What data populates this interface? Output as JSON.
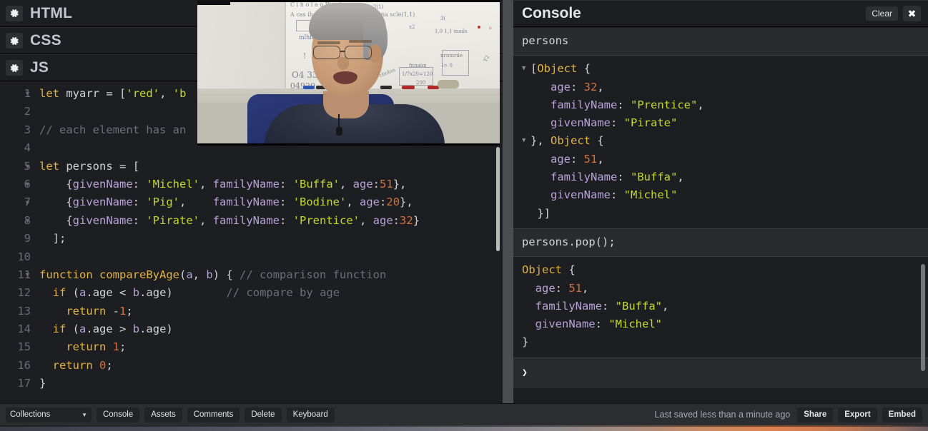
{
  "editor": {
    "panels": [
      {
        "label": "HTML",
        "icon": "gear-icon"
      },
      {
        "label": "CSS",
        "icon": "gear-icon"
      },
      {
        "label": "JS",
        "icon": "gear-icon"
      }
    ],
    "active_panel": "JS",
    "code_lines": [
      {
        "n": "1",
        "fold": true,
        "text": "let myarr = ['red', 'b"
      },
      {
        "n": "2",
        "fold": false,
        "text": ""
      },
      {
        "n": "3",
        "fold": false,
        "text": "// each element has an"
      },
      {
        "n": "4",
        "fold": false,
        "text": ""
      },
      {
        "n": "5",
        "fold": true,
        "text": "let persons = ["
      },
      {
        "n": "6",
        "fold": true,
        "text": "    {givenName: 'Michel', familyName: 'Buffa', age:51},"
      },
      {
        "n": "7",
        "fold": true,
        "text": "    {givenName: 'Pig',    familyName: 'Bodine', age:20},"
      },
      {
        "n": "8",
        "fold": true,
        "text": "    {givenName: 'Pirate', familyName: 'Prentice', age:32}"
      },
      {
        "n": "9",
        "fold": false,
        "text": "  ];"
      },
      {
        "n": "10",
        "fold": false,
        "text": ""
      },
      {
        "n": "11",
        "fold": true,
        "text": "function compareByAge(a, b) { // comparison function"
      },
      {
        "n": "12",
        "fold": false,
        "text": "  if (a.age < b.age)        // compare by age"
      },
      {
        "n": "13",
        "fold": false,
        "text": "    return -1;"
      },
      {
        "n": "14",
        "fold": false,
        "text": "  if (a.age > b.age)"
      },
      {
        "n": "15",
        "fold": false,
        "text": "    return 1;"
      },
      {
        "n": "16",
        "fold": false,
        "text": "  return 0;"
      },
      {
        "n": "17",
        "fold": false,
        "text": "}"
      }
    ]
  },
  "console": {
    "title": "Console",
    "clear_label": "Clear",
    "close_label": "✖",
    "entries": [
      {
        "type": "command",
        "text": "persons"
      },
      {
        "type": "output",
        "lines": [
          {
            "arrow": true,
            "text": "[Object {"
          },
          {
            "arrow": false,
            "text": "   age: 32,"
          },
          {
            "arrow": false,
            "text": "   familyName: \"Prentice\","
          },
          {
            "arrow": false,
            "text": "   givenName: \"Pirate\""
          },
          {
            "arrow": true,
            "text": "}, Object {"
          },
          {
            "arrow": false,
            "text": "   age: 51,"
          },
          {
            "arrow": false,
            "text": "   familyName: \"Buffa\","
          },
          {
            "arrow": false,
            "text": "   givenName: \"Michel\""
          },
          {
            "arrow": false,
            "text": " }]"
          }
        ]
      },
      {
        "type": "command",
        "text": "persons.pop();"
      },
      {
        "type": "output",
        "lines": [
          {
            "arrow": false,
            "text": "Object {"
          },
          {
            "arrow": false,
            "text": "  age: 51,"
          },
          {
            "arrow": false,
            "text": "  familyName: \"Buffa\","
          },
          {
            "arrow": false,
            "text": "  givenName: \"Michel\""
          },
          {
            "arrow": false,
            "text": "}"
          }
        ]
      }
    ],
    "prompt": "❯"
  },
  "bottombar": {
    "collections_label": "Collections",
    "left_buttons": [
      "Console",
      "Assets",
      "Comments",
      "Delete",
      "Keyboard"
    ],
    "saved_text": "Last saved less than a minute ago",
    "right_buttons": [
      "Share",
      "Export",
      "Embed"
    ]
  },
  "video": {
    "alt": "webcam overlay of presenter in front of whiteboard",
    "board_scrawls": [
      "C i h o i a o  Ifnnain",
      "A cas iha",
      "2(1)",
      "nrna  scle(1,1)",
      "x2",
      "1,0 1,1  mails",
      "nrnmrde",
      "l= 0",
      "fnnaim",
      "1/7x20=120",
      "200",
      "cholon",
      "O4  33",
      "04920"
    ]
  },
  "colors": {
    "app_bg": "#1d1e22",
    "panel_bg": "#1d1e22",
    "divider": "#4c4d51",
    "bottombar_bg": "#2c2d31",
    "keyword": "#e3b341",
    "string": "#c3d82c",
    "number": "#d2713b",
    "property": "#b7a2d8",
    "comment": "#6d6f75"
  }
}
